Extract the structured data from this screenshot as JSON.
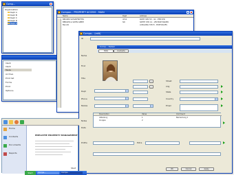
{
  "win1": {
    "title": "Comp...",
    "tree": [
      "Organisation",
      "Dept A",
      "Dept B",
      "Dept C",
      "Dept D",
      "Dept E"
    ]
  },
  "win1_lower": {
    "items": [
      "Ident",
      "Ident",
      "Tasks",
      "Archive",
      "Print list",
      "Forms",
      "Print",
      "Options"
    ]
  },
  "win2": {
    "title": "Compan... PROPERTY ACCESS - MAIN",
    "columns": [
      "Name",
      "",
      "Dept",
      "Address"
    ],
    "rows": [
      [
        "BECKER SCHLEIFMITTEL",
        "",
        "4711",
        "ROTH STR 55 - 41 - PTB STR"
      ],
      [
        "BERGER & SOHN GMBH",
        "",
        "SIC",
        "SMITH STR 12 - VELTRUP BADER"
      ],
      [
        "Benutz",
        "",
        "",
        "AUSGANG STR 8 - PORTUGUES"
      ]
    ]
  },
  "win3": {
    "title": "Compa... (edit)",
    "sub_title": "Comp... Detail",
    "tabs": [
      "Data",
      "Contacts"
    ],
    "labels": {
      "name": "Name",
      "first": "First",
      "title_l": "Title",
      "dept": "Dept",
      "phone": "Phone",
      "mobile": "Mobile",
      "fax": "Fax",
      "email": "Email",
      "street": "Street",
      "city": "City",
      "state": "State",
      "country": "Country",
      "notes": "Notes",
      "date": "Date",
      "profile": "Profile",
      "extra": "Extra"
    },
    "table_headers": [
      "Description",
      "Value",
      "Comment"
    ],
    "table_rows": [
      [
        "Abteilung",
        "1",
        "Bemerkung 1"
      ],
      [
        "Gruppe",
        "2",
        ""
      ]
    ],
    "buttons": [
      "OK",
      "Cancel",
      "Apply"
    ]
  },
  "launcher": {
    "items": [
      "Home",
      "Contacts",
      "Documents",
      "Reports"
    ],
    "header": "EMPLOYEE PROPERTY MANAGEMENT",
    "footer": "Start"
  },
  "taskbar": {
    "items": [
      "Start",
      "Compa...",
      "Compa..."
    ]
  },
  "colors": {
    "titlebar": "#0a3fb5",
    "window_bg": "#ece9d8",
    "selection": "#316ac5",
    "accent_green": "#1aa01a"
  }
}
